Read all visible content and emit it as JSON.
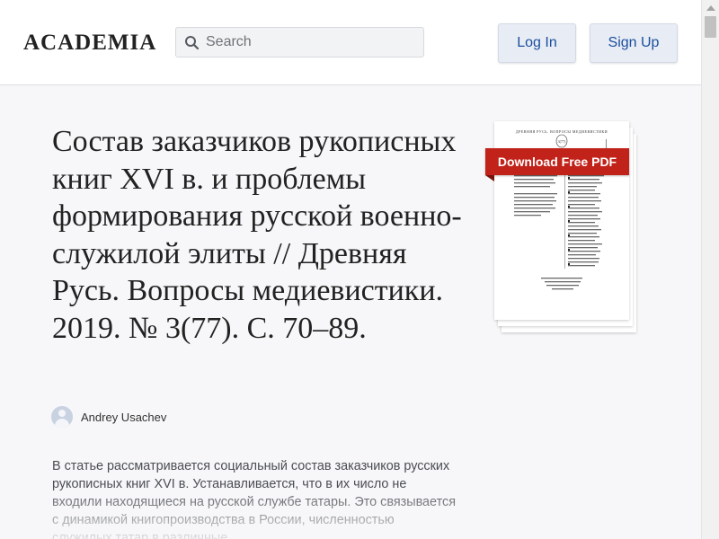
{
  "header": {
    "logo": "ACADEMIA",
    "search_placeholder": "Search",
    "login_label": "Log In",
    "signup_label": "Sign Up"
  },
  "paper": {
    "title": "Состав заказчиков рукописных книг XVI в. и проблемы формирования русской военно-служилой элиты // Древняя Русь. Вопросы медиевистики. 2019. № 3(77). С. 70–89.",
    "author": "Andrey Usachev",
    "abstract": "В статье рассматривается социальный состав заказчиков русских рукописных книг XVI в. Устанавливается, что в их число не входили находящиеся на русской службе татары. Это связывается с динамикой книгопроизводства в России, численностью служилых татар в различные"
  },
  "pdf": {
    "download_label": "Download Free PDF",
    "page_number": "3(77)"
  },
  "colors": {
    "ribbon": "#c1231a",
    "button_text": "#1a4f9c",
    "button_bg": "#e8ecf5"
  }
}
